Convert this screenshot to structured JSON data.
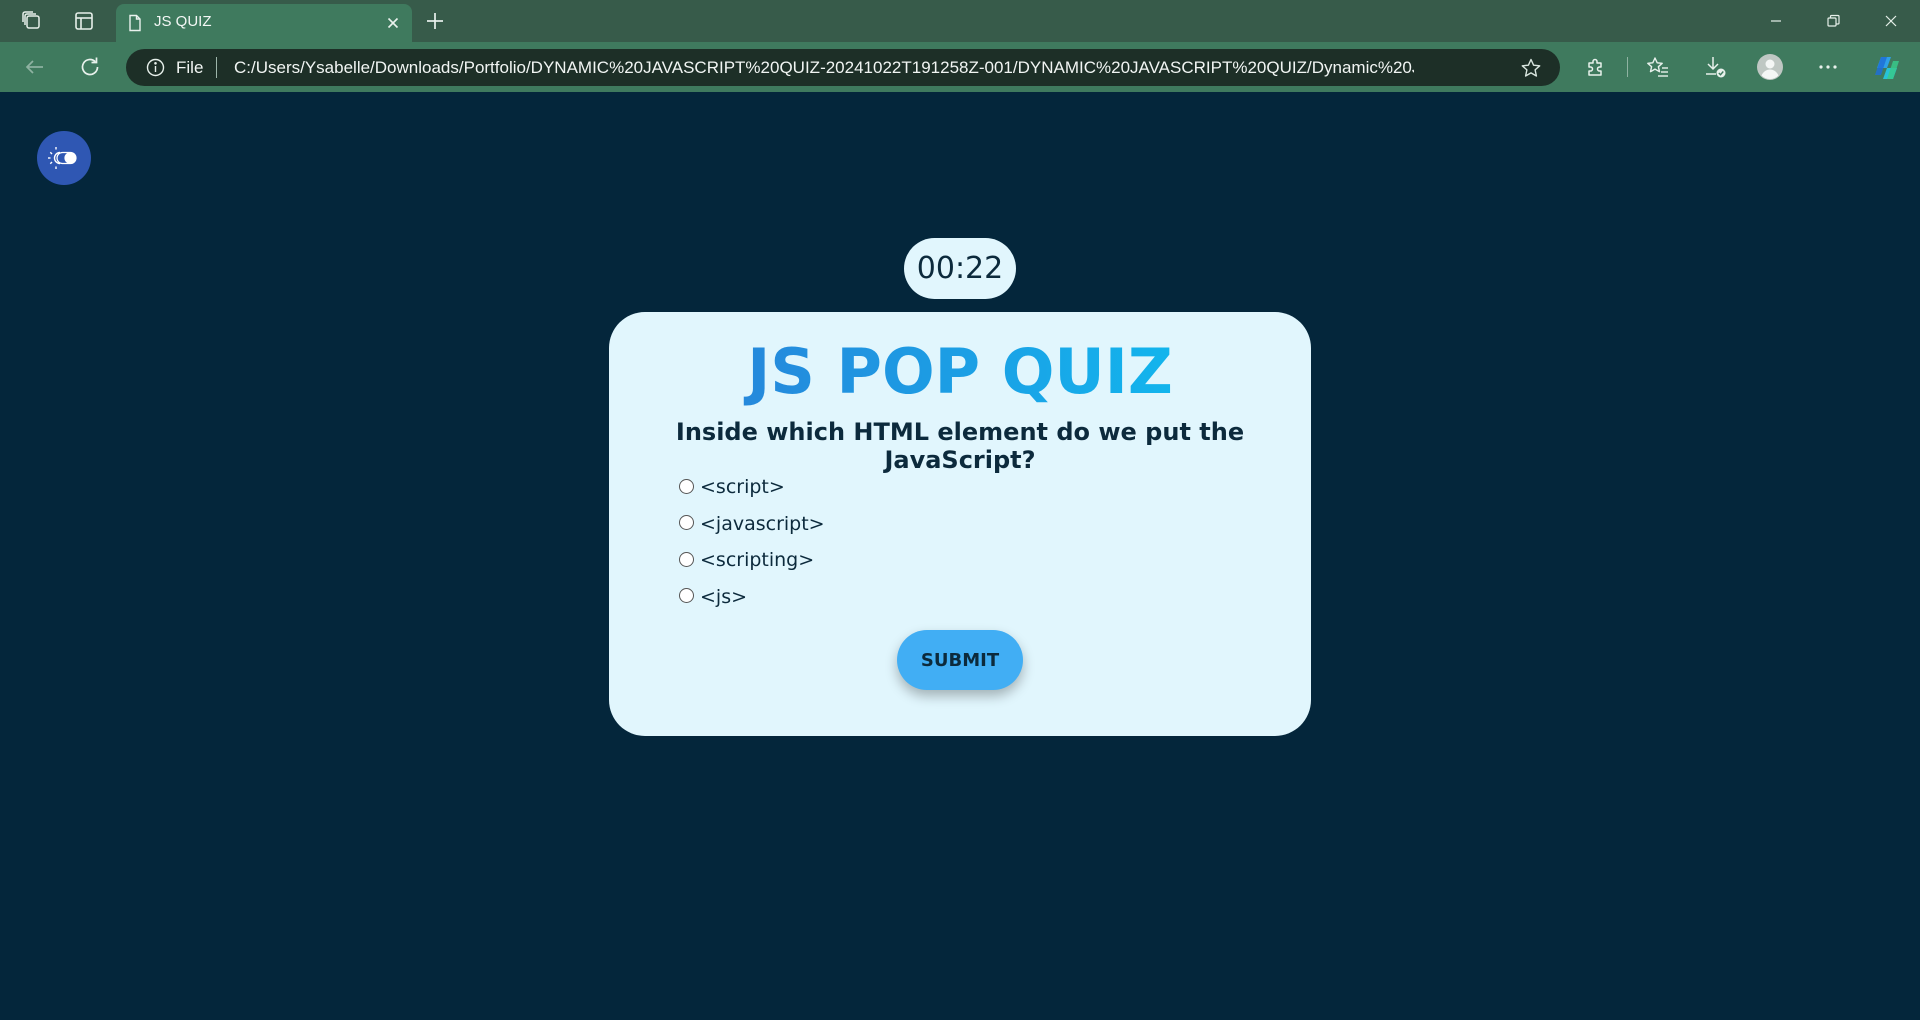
{
  "browser": {
    "tab": {
      "title": "JS QUIZ"
    },
    "address": {
      "scheme_label": "File",
      "url": "C:/Users/Ysabelle/Downloads/Portfolio/DYNAMIC%20JAVASCRIPT%20QUIZ-20241022T191258Z-001/DYNAMIC%20JAVASCRIPT%20QUIZ/Dynamic%20Javascript..."
    },
    "accent": "#3f7a5e"
  },
  "page": {
    "background": "#04263b",
    "timer": "00:22",
    "title": "JS POP QUIZ",
    "question": "Inside which HTML element do we put the JavaScript?",
    "options": [
      {
        "label": "<script>"
      },
      {
        "label": "<javascript>"
      },
      {
        "label": "<scripting>"
      },
      {
        "label": "<js>"
      }
    ],
    "submit_label": "SUBMIT",
    "card_color": "#e1f6fd",
    "button_color": "#41aef4"
  }
}
